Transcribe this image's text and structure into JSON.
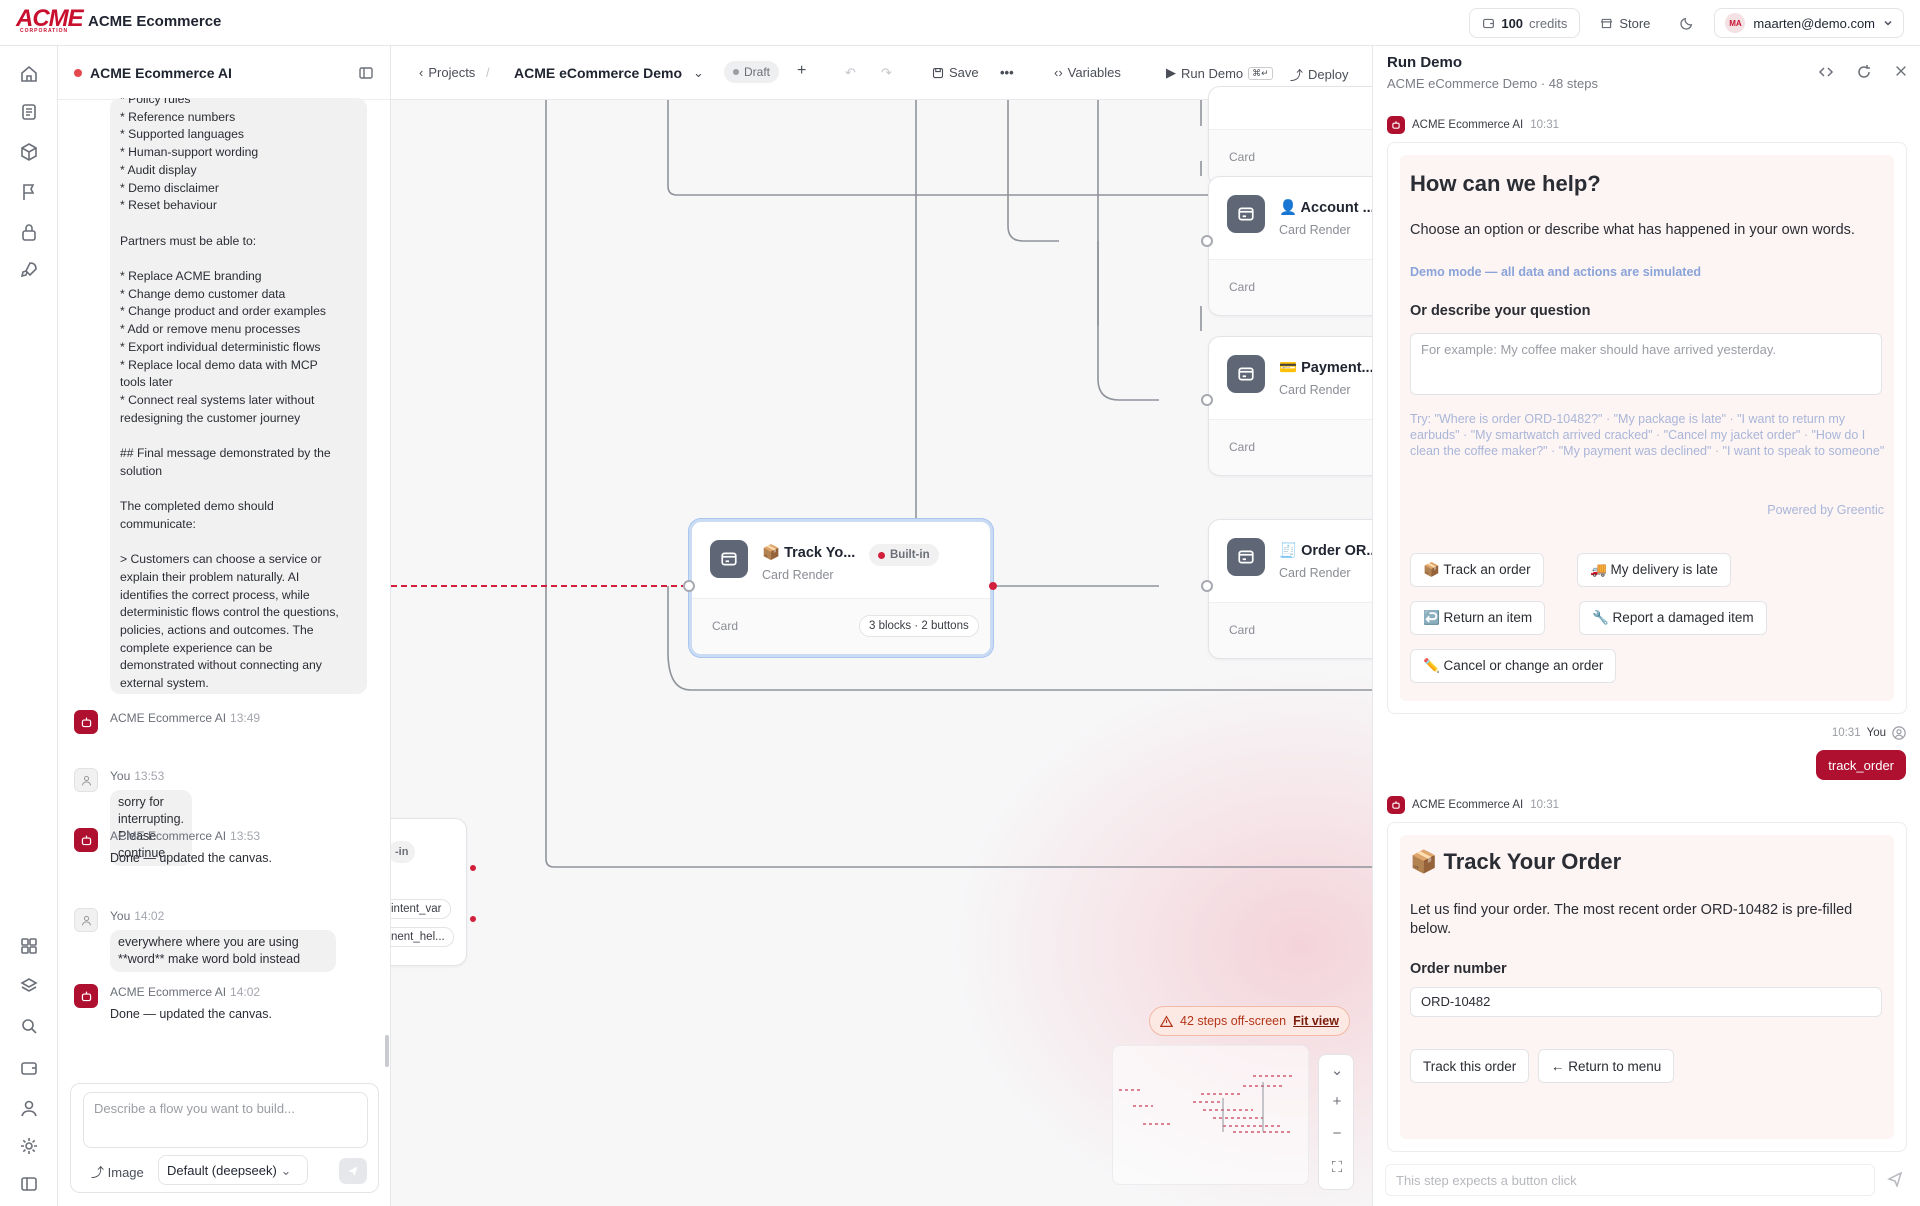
{
  "topbar": {
    "logo_text": "ACME",
    "logo_subtext": "CORPORATION",
    "app_title": "ACME Ecommerce",
    "credits_value": "100",
    "credits_label": "credits",
    "store_label": "Store",
    "user_initials": "MA",
    "user_email": "maarten@demo.com"
  },
  "chat": {
    "title": "ACME Ecommerce AI",
    "long_message_lines": [
      "* Policy rules",
      "* Reference numbers",
      "* Supported languages",
      "* Human-support wording",
      "* Audit display",
      "* Demo disclaimer",
      "* Reset behaviour",
      "",
      "Partners must be able to:",
      "",
      "* Replace ACME branding",
      "* Change demo customer data",
      "* Change product and order examples",
      "* Add or remove menu processes",
      "* Export individual deterministic flows",
      "* Replace local demo data with MCP",
      "tools later",
      "* Connect real systems later without",
      "redesigning the customer journey",
      "",
      "## Final message demonstrated by the",
      "solution",
      "",
      "The completed demo should",
      "communicate:",
      "",
      "> Customers can choose a service or",
      "explain their problem naturally. AI",
      "identifies the correct process, while",
      "deterministic flows control the questions,",
      "policies, actions and outcomes. The",
      "complete experience can be",
      "demonstrated without connecting any",
      "external system."
    ],
    "messages": [
      {
        "author": "ACME Ecommerce AI",
        "time": "13:49",
        "text": ""
      },
      {
        "author": "You",
        "time": "13:53",
        "text": "sorry for interrupting. Please continue"
      },
      {
        "author": "ACME Ecommerce AI",
        "time": "13:53",
        "text": "Done — updated the canvas."
      },
      {
        "author": "You",
        "time": "14:02",
        "text": "everywhere where you are using **word** make word bold instead"
      },
      {
        "author": "ACME Ecommerce AI",
        "time": "14:02",
        "text": "Done — updated the canvas."
      }
    ],
    "composer_placeholder": "Describe a flow you want to build...",
    "image_label": "Image",
    "model_label": "Default (deepseek)"
  },
  "canvas": {
    "breadcrumb_projects": "Projects",
    "project_name": "ACME eCommerce Demo",
    "status": "Draft",
    "save_label": "Save",
    "variables_label": "Variables",
    "run_demo_label": "Run Demo",
    "deploy_label": "Deploy",
    "nodes": [
      {
        "title": "",
        "subtitle": "",
        "footer": "Card"
      },
      {
        "title": "👤 Account ...",
        "subtitle": "Card Render",
        "footer": "Card"
      },
      {
        "title": "💳 Payment...",
        "subtitle": "Card Render",
        "footer": "Card"
      },
      {
        "title": "📦 Track Yo...",
        "subtitle": "Card Render",
        "footer": "Card",
        "badge": "Built-in",
        "blocks": "3 blocks · 2 buttons"
      },
      {
        "title": "🧾 Order OR...",
        "subtitle": "Card Render",
        "footer": "Card"
      }
    ],
    "partial_node": {
      "badge": "-in",
      "chip1": "intent_var",
      "chip2": "nent_hel..."
    },
    "offscreen_warning": "42 steps off-screen",
    "fit_view": "Fit view"
  },
  "run_demo": {
    "title": "Run Demo",
    "subtitle": "ACME eCommerce Demo · 48 steps",
    "ai_author": "ACME Ecommerce AI",
    "ai_time_1": "10:31",
    "help_title": "How can we help?",
    "help_text": "Choose an option or describe what has happened in your own words.",
    "demo_mode": "Demo mode — all data and actions are simulated",
    "describe_label": "Or describe your question",
    "describe_placeholder": "For example: My coffee maker should have arrived yesterday.",
    "tries": "Try: \"Where is order ORD-10482?\" · \"My package is late\" · \"I want to return my earbuds\" · \"My smartwatch arrived cracked\" · \"Cancel my jacket order\" · \"How do I clean the coffee maker?\" · \"My payment was declined\" · \"I want to speak to someone\"",
    "powered_by": "Powered by Greentic",
    "options": [
      "📦 Track an order",
      "🚚 My delivery is late",
      "↩️ Return an item",
      "🔧 Report a damaged item",
      "✏️ Cancel or change an order"
    ],
    "you_time": "10:31",
    "you_label": "You",
    "you_message": "track_order",
    "ai_time_2": "10:31",
    "track_title": "📦 Track Your Order",
    "track_text": "Let us find your order. The most recent order ORD-10482 is pre-filled below.",
    "order_label": "Order number",
    "order_value": "ORD-10482",
    "track_btn": "Track this order",
    "menu_btn": "← Return to menu",
    "input_placeholder": "This step expects a button click"
  },
  "colors": {
    "brand": "#C8102E",
    "accent_dark": "#B01030",
    "node_icon": "#5F6776",
    "link_blue": "#8AA3D8"
  }
}
